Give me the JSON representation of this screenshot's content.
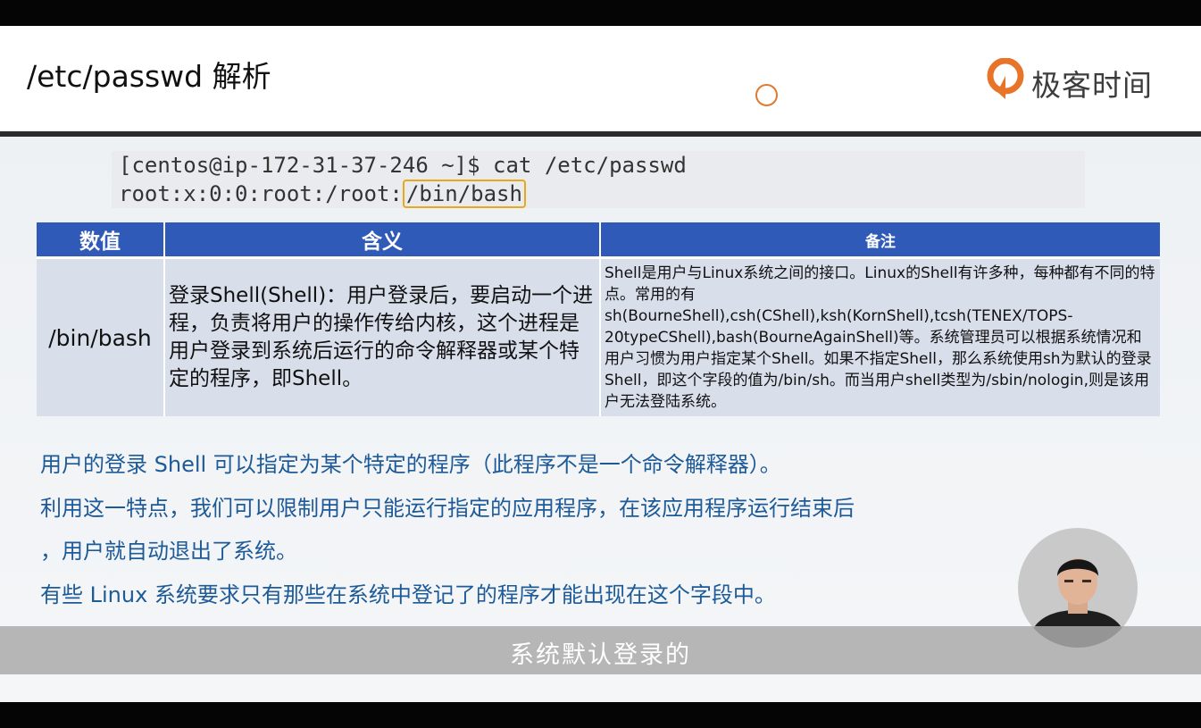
{
  "slide": {
    "title": "/etc/passwd 解析"
  },
  "logo": {
    "text": "极客时间",
    "accent_color": "#e8742a"
  },
  "code": {
    "line1": "[centos@ip-172-31-37-246 ~]$ cat /etc/passwd",
    "line2_prefix": "root:x:0:0:root:/root:",
    "line2_highlight": "/bin/bash",
    "highlight_color": "#e8a81a"
  },
  "table": {
    "headers": [
      "数值",
      "含义",
      "备注"
    ],
    "row": {
      "value": "/bin/bash",
      "meaning": "登录Shell(Shell)：用户登录后，要启动一个进程，负责将用户的操作传给内核，这个进程是用户登录到系统后运行的命令解释器或某个特定的程序，即Shell。",
      "remark": "Shell是用户与Linux系统之间的接口。Linux的Shell有许多种，每种都有不同的特点。常用的有sh(BourneShell),csh(CShell),ksh(KornShell),tcsh(TENEX/TOPS-20typeCShell),bash(BourneAgainShell)等。系统管理员可以根据系统情况和用户习惯为用户指定某个Shell。如果不指定Shell，那么系统使用sh为默认的登录Shell，即这个字段的值为/bin/sh。而当用户shell类型为/sbin/nologin,则是该用户无法登陆系统。"
    },
    "header_color": "#2f5ab8",
    "cell_color": "#d9deeb"
  },
  "paragraphs": [
    "用户的登录 Shell 可以指定为某个特定的程序（此程序不是一个命令解释器）。",
    "利用这一特点，我们可以限制用户只能运行指定的应用程序，在该应用程序运行结束后",
    "，用户就自动退出了系统。",
    "有些 Linux 系统要求只有那些在系统中登记了的程序才能出现在这个字段中。"
  ],
  "paragraph_color": "#1d5a97",
  "subtitle": "系统默认登录的"
}
